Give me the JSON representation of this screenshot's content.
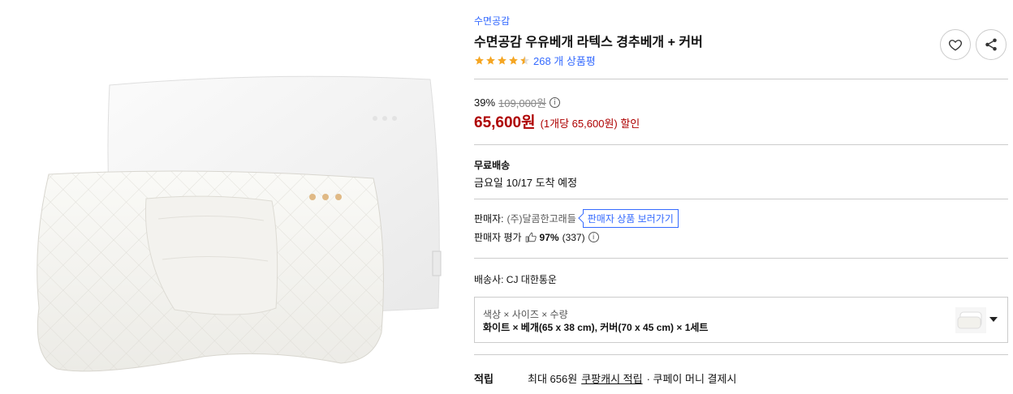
{
  "product": {
    "brand": "수면공감",
    "title": "수면공감 우유베개 라텍스 경추베개 + 커버",
    "rating_stars": 4.5,
    "review_count": "268 개 상품평",
    "image_alt": "pillow-product-image"
  },
  "actions": {
    "wishlist": "heart-icon",
    "share": "share-icon"
  },
  "price": {
    "discount_rate": "39%",
    "original_price": "109,000원",
    "sale_price": "65,600원",
    "unit_price": "(1개당 65,600원) 할인"
  },
  "shipping": {
    "title": "무료배송",
    "arrival": "금요일 10/17 도착 예정"
  },
  "seller": {
    "label": "판매자:",
    "name": "(주)달콤한고래들",
    "link_label": "판매자 상품 보러가기",
    "eval_label": "판매자 평가",
    "eval_percent": "97%",
    "eval_count": "(337)"
  },
  "carrier": "배송사:  CJ 대한통운",
  "option": {
    "label": "색상 × 사이즈 × 수량",
    "value": "화이트 × 베개(65 x 38 cm), 커버(70 x 45 cm) × 1세트"
  },
  "reward": {
    "label": "적립",
    "amount": "최대 656원",
    "link": "쿠팡캐시 적립",
    "suffix": "· 쿠페이 머니 결제시"
  },
  "colors": {
    "accent_blue": "#346aff",
    "price_red": "#ae0000",
    "star_orange": "#f5a623"
  }
}
